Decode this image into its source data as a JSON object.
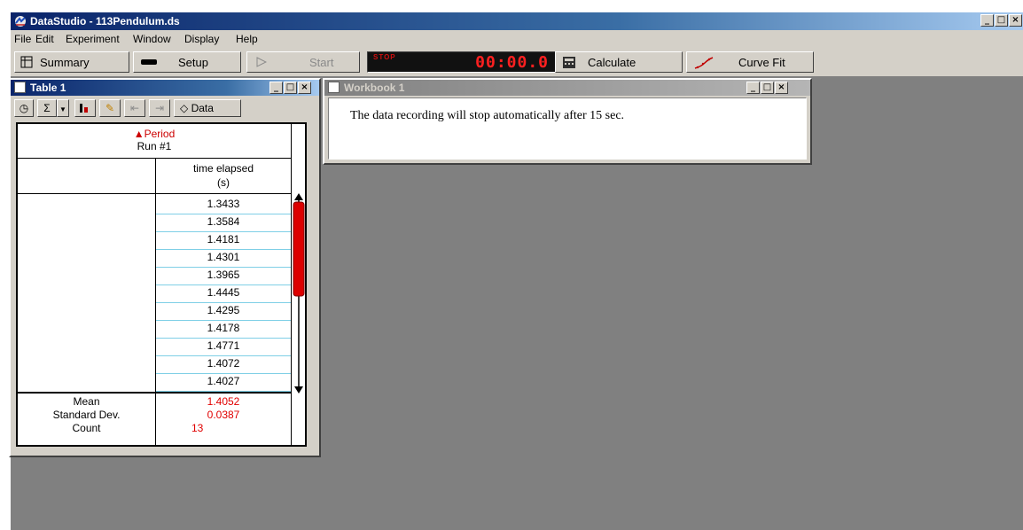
{
  "app": {
    "title": "DataStudio - 113Pendulum.ds"
  },
  "menu": [
    {
      "label": "File"
    },
    {
      "label": "Edit"
    },
    {
      "label": "Experiment"
    },
    {
      "label": "Window"
    },
    {
      "label": "Display"
    },
    {
      "label": "Help"
    }
  ],
  "toolbar": {
    "summary": "Summary",
    "setup": "Setup",
    "start": "Start",
    "stop_indicator": "STOP",
    "timer": "00:00.0",
    "calculate": "Calculate",
    "curve_fit": "Curve Fit"
  },
  "table_window": {
    "title": "Table 1",
    "data_button": "Data",
    "measurement": "Period",
    "run": "Run #1",
    "column_header_line1": "time elapsed",
    "column_header_line2": "(s)",
    "rows": [
      "1.3433",
      "1.3584",
      "1.4181",
      "1.4301",
      "1.3965",
      "1.4445",
      "1.4295",
      "1.4178",
      "1.4771",
      "1.4072",
      "1.4027"
    ],
    "stats": {
      "mean_label": "Mean",
      "mean_value": "1.4052",
      "std_label": "Standard Dev.",
      "std_value": "0.0387",
      "count_label": "Count",
      "count_value": "13"
    },
    "scrollbar_position": 0.3
  },
  "workbook_window": {
    "title": "Workbook 1",
    "message": "The data recording will stop automatically after 15 sec."
  },
  "colors": {
    "accent_red": "#cc0000",
    "stat_red": "#e00000",
    "row_border": "#7fcfe6",
    "workspace": "#808080"
  }
}
